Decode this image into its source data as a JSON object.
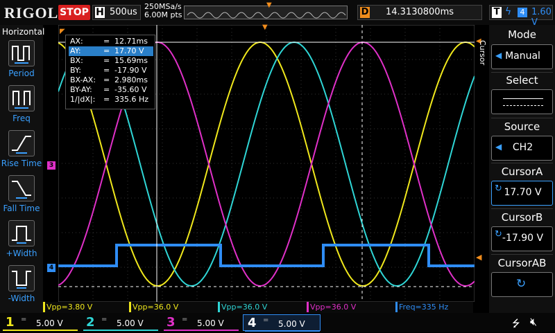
{
  "brand": "RIGOL",
  "run_state": "STOP",
  "horizontal": {
    "letter": "H",
    "timebase": "500us",
    "sample_rate": "250MSa/s",
    "memory_depth": "6.00M pts"
  },
  "delay": {
    "letter": "D",
    "value": "14.3130800ms"
  },
  "trigger": {
    "letter": "T",
    "source": "4",
    "level": "1.60 V"
  },
  "left_panel": {
    "title": "Horizontal",
    "items": [
      {
        "label": "Period",
        "icon": "period-icon"
      },
      {
        "label": "Freq",
        "icon": "freq-icon"
      },
      {
        "label": "Rise Time",
        "icon": "rise-time-icon"
      },
      {
        "label": "Fall Time",
        "icon": "fall-time-icon"
      },
      {
        "label": "+Width",
        "icon": "pos-width-icon"
      },
      {
        "label": "-Width",
        "icon": "neg-width-icon"
      }
    ]
  },
  "cursor_panel": {
    "vertical_label": "Cursor",
    "rows": [
      {
        "key": "AX:",
        "value": "12.71ms"
      },
      {
        "key": "AY:",
        "value": "17.70 V"
      },
      {
        "key": "BX:",
        "value": "15.69ms"
      },
      {
        "key": "BY:",
        "value": "-17.90 V"
      },
      {
        "key": "BX-AX:",
        "value": "2.980ms"
      },
      {
        "key": "BY-AY:",
        "value": "-35.60 V"
      },
      {
        "key": "1/|dX|:",
        "value": "335.6 Hz"
      }
    ],
    "equals": "="
  },
  "right_menu": {
    "mode_title": "Mode",
    "mode_value": "Manual",
    "select_title": "Select",
    "source_title": "Source",
    "source_value": "CH2",
    "cursora_title": "CursorA",
    "cursora_value": "17.70 V",
    "cursorb_title": "CursorB",
    "cursorb_value": "-17.90 V",
    "cursorab_title": "CursorAB"
  },
  "measurements": [
    "Vpp=3.80 V",
    "Vpp=36.0 V",
    "Vpp=36.0 V",
    "Vpp=36.0 V",
    "Freq=335 Hz"
  ],
  "channels": [
    {
      "num": "1",
      "coupling": "=",
      "scale": "5.00 V",
      "color": "#f0e81c"
    },
    {
      "num": "2",
      "coupling": "=",
      "scale": "5.00 V",
      "color": "#2fd6d6"
    },
    {
      "num": "3",
      "coupling": "=",
      "scale": "5.00 V",
      "color": "#e030c8"
    },
    {
      "num": "4",
      "coupling": "=",
      "scale": "5.00 V",
      "color": "#2f8df5"
    }
  ],
  "ch_markers": [
    "3",
    "4"
  ],
  "colors": {
    "ch1": "#f0e81c",
    "ch2": "#2fd6d6",
    "ch3": "#e030c8",
    "ch4": "#2f8df5",
    "accent": "#f08c1c",
    "stop": "#d92020"
  },
  "icons": {
    "usb": "usb-icon",
    "speaker": "speaker-muted-icon"
  }
}
